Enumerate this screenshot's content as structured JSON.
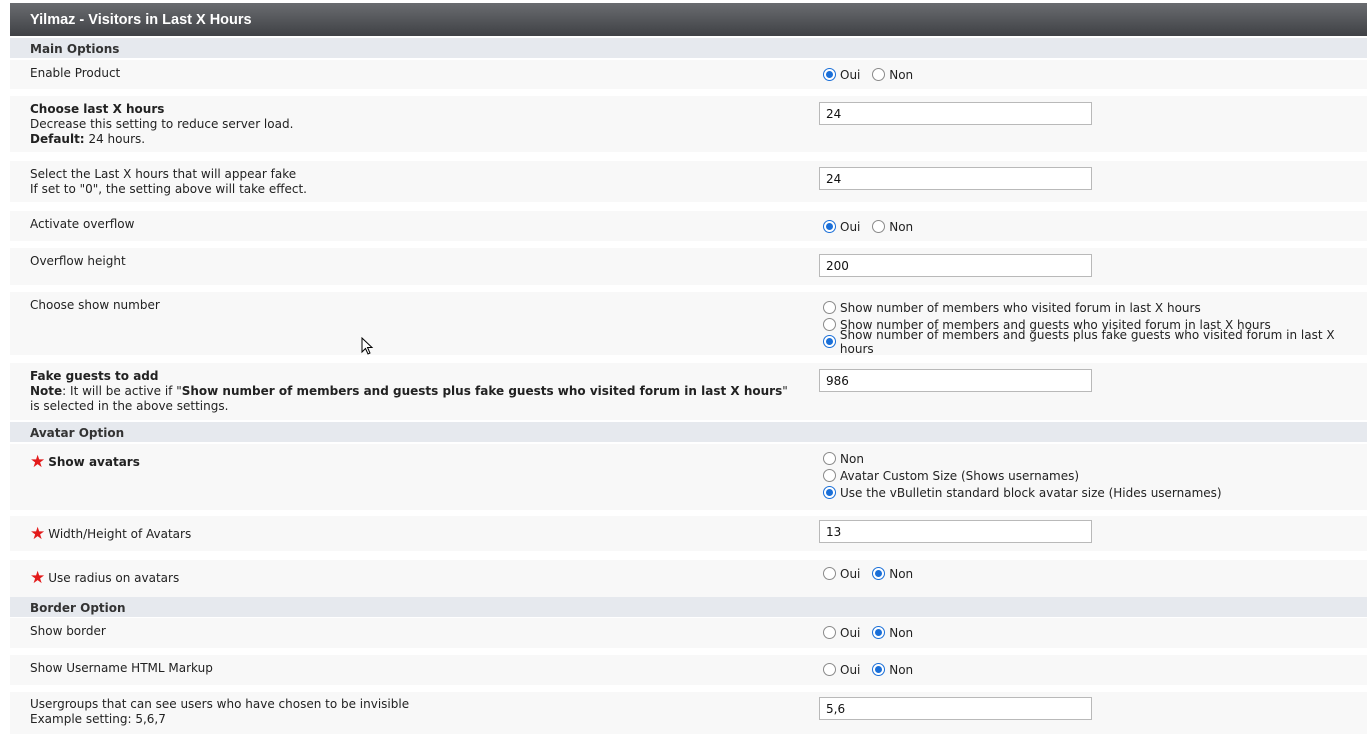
{
  "title": "Yilmaz - Visitors in Last X Hours",
  "sections": {
    "main": "Main Options",
    "avatar": "Avatar Option",
    "border": "Border Option"
  },
  "radio_labels": {
    "yes": "Oui",
    "no": "Non"
  },
  "rows": {
    "enable_product": {
      "label": "Enable Product",
      "selected": "Oui"
    },
    "last_hours": {
      "label": "Choose last X hours",
      "desc": "Decrease this setting to reduce server load.",
      "default_label": "Default:",
      "default_value": "24 hours.",
      "value": "24"
    },
    "fake_hours": {
      "label": "Select the Last X hours that will appear fake",
      "desc": "If set to \"0\", the setting above will take effect.",
      "value": "24"
    },
    "activate_overflow": {
      "label": "Activate overflow",
      "selected": "Oui"
    },
    "overflow_height": {
      "label": "Overflow height",
      "value": "200"
    },
    "show_number": {
      "label": "Choose show number",
      "options": [
        "Show number of members who visited forum in last X hours",
        "Show number of members and guests who visited forum in last X hours",
        "Show number of members and guests plus fake guests who visited forum in last X hours"
      ],
      "selected_index": 2
    },
    "fake_guests": {
      "label": "Fake guests to add",
      "note_label": "Note",
      "note_pre": ": It will be active if \"",
      "note_bold": "Show number of members and guests plus fake guests who visited forum in last X hours",
      "note_post": "\" is selected in the above settings.",
      "value": "986"
    },
    "show_avatars": {
      "label": "Show avatars",
      "options": [
        "Non",
        "Avatar Custom Size (Shows usernames)",
        "Use the vBulletin standard block avatar size (Hides usernames)"
      ],
      "selected_index": 2
    },
    "avatar_size": {
      "label": "Width/Height of Avatars",
      "value": "13"
    },
    "avatar_radius": {
      "label": "Use radius on avatars",
      "selected": "Non"
    },
    "show_border": {
      "label": "Show border",
      "selected": "Non"
    },
    "username_markup": {
      "label": "Show Username HTML Markup",
      "selected": "Non"
    },
    "invisible_groups": {
      "label": "Usergroups that can see users who have chosen to be invisible",
      "desc": "Example setting: 5,6,7",
      "value": "5,6"
    }
  },
  "colors": {
    "accent": "#1a6fd8",
    "required_star": "#e31b1b",
    "titlebar": "#4a4c50",
    "section_bg": "#e6e9ee"
  }
}
